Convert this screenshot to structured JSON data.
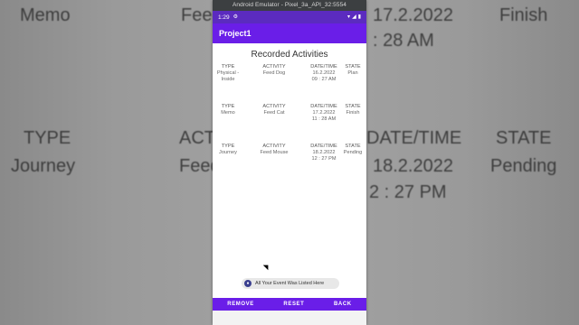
{
  "background_text": {
    "top_left": "Memo",
    "top_mid_left": "Feed",
    "top_mid_right": "17.2.2022",
    "top_right": "Finish",
    "top_mid_right_2": ": 28 AM",
    "mid_left": "TYPE",
    "mid_mid": "ACT",
    "mid_mid_right": "DATE/TIME",
    "mid_right": "STATE",
    "low_left": "Journey",
    "low_mid": "Feed",
    "low_mid_right": "18.2.2022",
    "low_right": "Pending",
    "low_mid_right_2": "2 : 27 PM"
  },
  "emulator": {
    "title": "Android Emulator - Pixel_3a_API_32:5554"
  },
  "status_bar": {
    "time": "1:29",
    "gear_icon": "gear-icon",
    "wifi_icon": "wifi-icon",
    "signal_icon": "signal-icon",
    "battery_icon": "battery-icon"
  },
  "app_bar": {
    "title": "Project1"
  },
  "page": {
    "title": "Recorded Activities"
  },
  "records": [
    {
      "type_label": "TYPE",
      "type_value": "Physical -\nInside",
      "activity_label": "ACTIVITY",
      "activity_value": "Feed Dog",
      "datetime_label": "DATE/TIME",
      "datetime_value": "16.2.2022\n09 : 27 AM",
      "state_label": "STATE",
      "state_value": "Plan"
    },
    {
      "type_label": "TYPE",
      "type_value": "Memo",
      "activity_label": "ACTIVITY",
      "activity_value": "Feed Cat",
      "datetime_label": "DATE/TIME",
      "datetime_value": "17.2.2022\n11 : 28 AM",
      "state_label": "STATE",
      "state_value": "Finish"
    },
    {
      "type_label": "TYPE",
      "type_value": "Journey",
      "activity_label": "ACTIVITY",
      "activity_value": "Feed Mouse",
      "datetime_label": "DATE/TIME",
      "datetime_value": "18.2.2022\n12 : 27 PM",
      "state_label": "STATE",
      "state_value": "Pending"
    }
  ],
  "toast": {
    "text": "All Your Event Was Listed Here",
    "icon": "app-icon"
  },
  "bottom_buttons": {
    "remove": "REMOVE",
    "reset": "RESET",
    "back": "BACK"
  },
  "colors": {
    "app_bar": "#6a1ee8",
    "status_bar": "#5b2bbf",
    "bottom_bar": "#6a1ee8"
  }
}
